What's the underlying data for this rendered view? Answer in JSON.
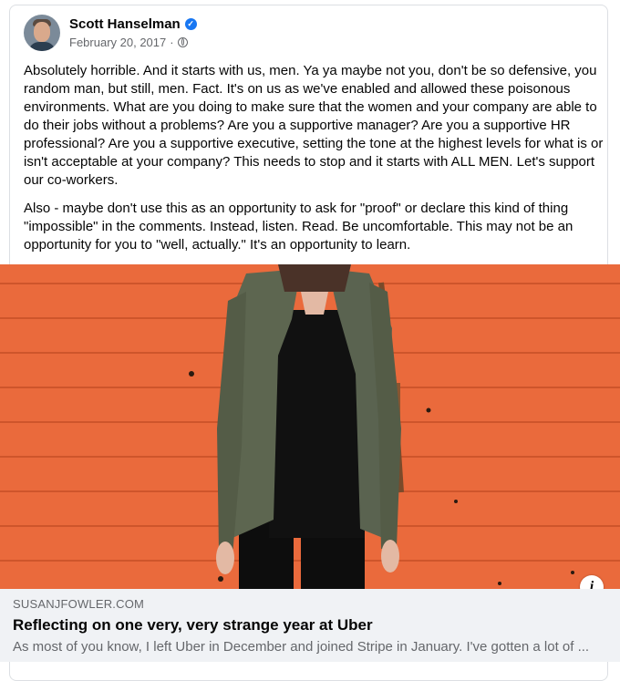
{
  "post": {
    "author": "Scott Hanselman",
    "date": "February 20, 2017",
    "separator": "·",
    "paragraphs": [
      "Absolutely horrible. And it starts with us, men. Ya ya maybe not you, don't be so defensive, you random man, but still, men. Fact. It's on us as we've enabled and allowed these poisonous environments. What are you doing to make sure that the women and your company are able to do their jobs without a problems? Are you a supportive manager? Are you a supportive HR professional? Are you a supportive executive, setting the tone at the highest levels for what is or isn't acceptable at your company? This needs to stop and it starts with ALL MEN. Let's support our co-workers.",
      "Also - maybe don't use this as an opportunity to ask for \"proof\" or declare this kind of thing \"impossible\" in the comments. Instead, listen. Read. Be uncomfortable. This may not be an opportunity for you to \"well, actually.\" It's an opportunity to learn."
    ]
  },
  "icons": {
    "verified": "verified-badge-icon",
    "audience": "globe-icon",
    "info": "info-icon"
  },
  "link": {
    "domain": "SUSANJFOWLER.COM",
    "title": "Reflecting on one very, very strange year at Uber",
    "description": "As most of you know, I left Uber in December and joined Stripe in January. I've gotten a lot of ..."
  },
  "colors": {
    "accent": "#1877f2",
    "wall": "#ea6a3c",
    "preview_bg": "#f0f2f5",
    "secondary_text": "#65676b"
  }
}
